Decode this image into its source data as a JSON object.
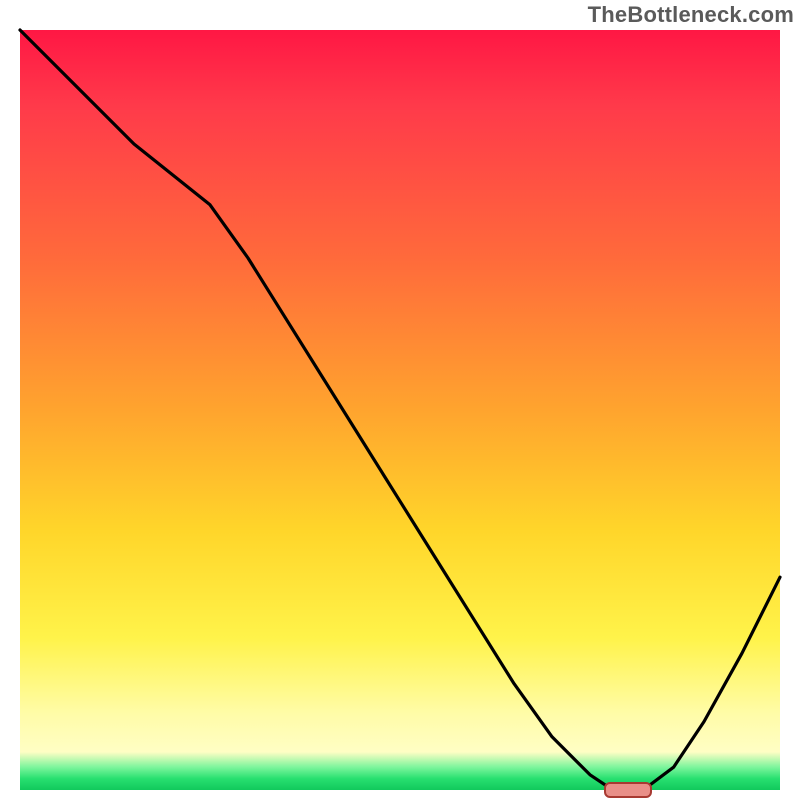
{
  "watermark": "TheBottleneck.com",
  "chart_data": {
    "type": "line",
    "title": "",
    "xlabel": "",
    "ylabel": "",
    "xlim": [
      0,
      100
    ],
    "ylim": [
      0,
      100
    ],
    "grid": false,
    "legend": false,
    "x": [
      0,
      5,
      10,
      15,
      20,
      25,
      30,
      35,
      40,
      45,
      50,
      55,
      60,
      65,
      70,
      75,
      78,
      82,
      86,
      90,
      95,
      100
    ],
    "values": [
      100,
      95,
      90,
      85,
      81,
      77,
      70,
      62,
      54,
      46,
      38,
      30,
      22,
      14,
      7,
      2,
      0,
      0,
      3,
      9,
      18,
      28
    ],
    "optimum_x": 80,
    "optimum_y": 0,
    "gradient_stops": [
      {
        "pos": 0,
        "color": "#ff1744"
      },
      {
        "pos": 50,
        "color": "#ffa42e"
      },
      {
        "pos": 80,
        "color": "#fff34a"
      },
      {
        "pos": 97,
        "color": "#7cf59c"
      },
      {
        "pos": 100,
        "color": "#11c95c"
      }
    ]
  }
}
